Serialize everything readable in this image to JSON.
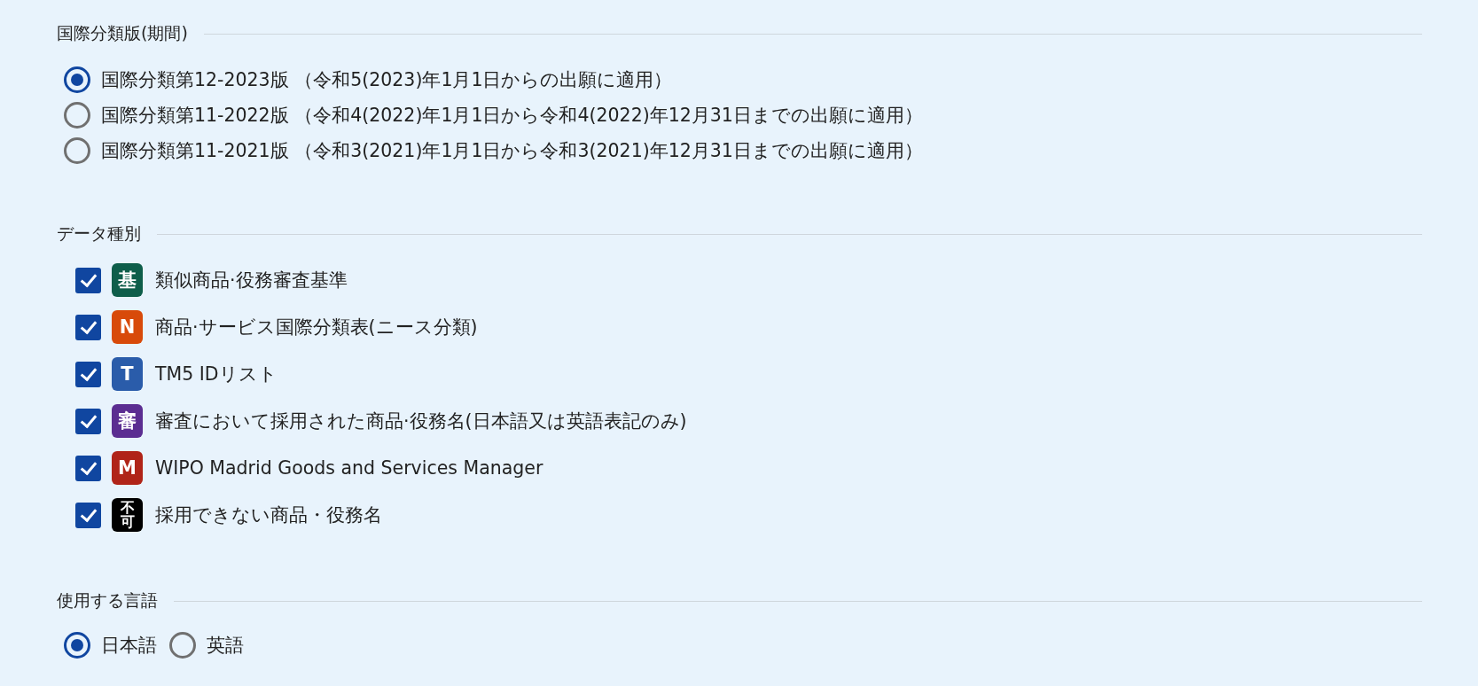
{
  "sections": [
    {
      "kind": "radio",
      "legend": "国際分類版(期間)",
      "options": [
        {
          "label": "国際分類第12-2023版 （令和5(2023)年1月1日からの出願に適用）",
          "selected": true
        },
        {
          "label": "国際分類第11-2022版 （令和4(2022)年1月1日から令和4(2022)年12月31日までの出願に適用）",
          "selected": false
        },
        {
          "label": "国際分類第11-2021版 （令和3(2021)年1月1日から令和3(2021)年12月31日までの出願に適用）",
          "selected": false
        }
      ]
    },
    {
      "kind": "checkbox",
      "legend": "データ種別",
      "options": [
        {
          "badge": "基",
          "color": "#0e5e4a",
          "label": "類似商品·役務審査基準",
          "checked": true
        },
        {
          "badge": "N",
          "color": "#d84a0a",
          "label": "商品·サービス国際分類表(ニース分類)",
          "checked": true
        },
        {
          "badge": "T",
          "color": "#2a5caa",
          "label": "TM5 IDリスト",
          "checked": true
        },
        {
          "badge": "審",
          "color": "#5b2d91",
          "label": "審査において採用された商品·役務名(日本語又は英語表記のみ)",
          "checked": true
        },
        {
          "badge": "M",
          "color": "#b02418",
          "label": "WIPO Madrid Goods and Services Manager",
          "checked": true
        },
        {
          "badge": "不可",
          "color": "#000000",
          "label": "採用できない商品・役務名",
          "checked": true
        }
      ]
    },
    {
      "kind": "inline-radio",
      "legend": "使用する言語",
      "options": [
        {
          "label": "日本語",
          "selected": true
        },
        {
          "label": "英語",
          "selected": false
        }
      ]
    }
  ]
}
